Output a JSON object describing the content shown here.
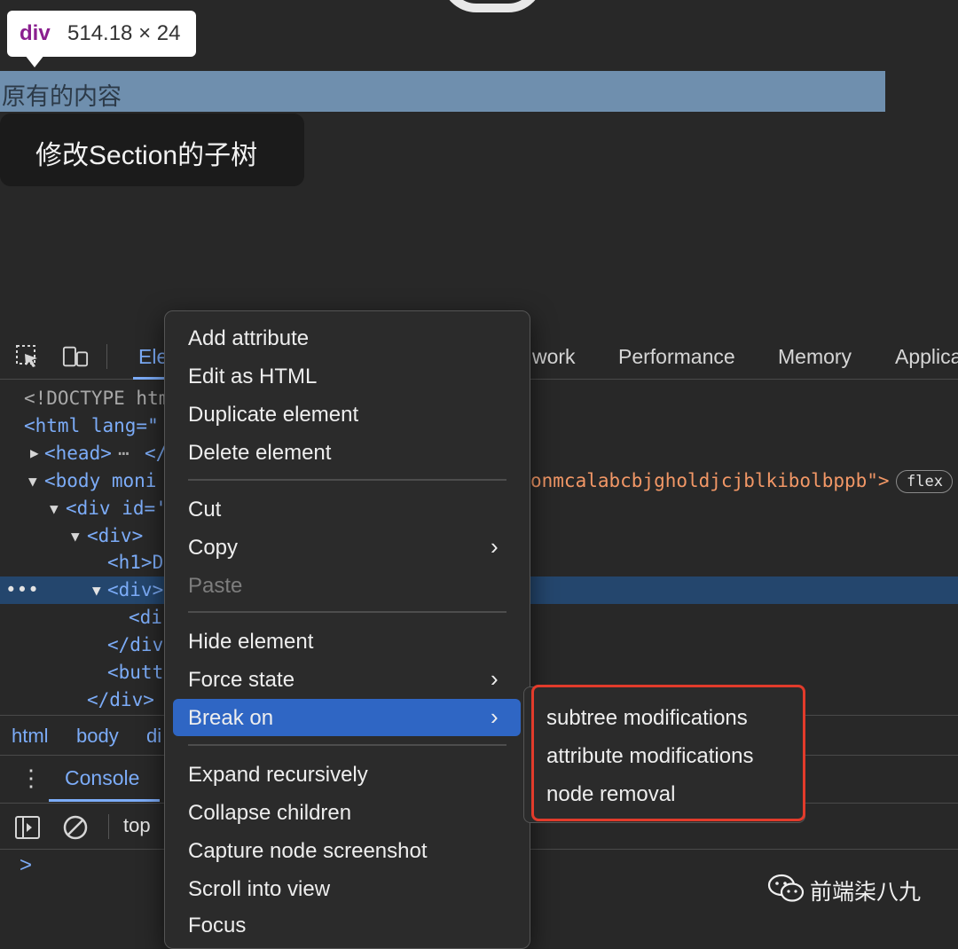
{
  "preview": {
    "tooltip_tag": "div",
    "tooltip_size": "514.18 × 24",
    "highlight_text": "原有的内容",
    "button_label": "修改Section的子树"
  },
  "tabs": {
    "elements": "Ele",
    "network": "work",
    "performance": "Performance",
    "memory": "Memory",
    "application": "Applica"
  },
  "dom": {
    "doctype": "<!DOCTYPE htm",
    "html_open": "<html lang=\"",
    "head": "<head>",
    "head_close": "</",
    "body_open": "<body moni",
    "body_attr_value": "onmcalabcbjgholdjcjblkibolbppb\">",
    "div_id": "<div id='",
    "div": "<div>",
    "h1": "<h1>D",
    "selected_div": "<div>",
    "inner_div": "<di",
    "div_close": "</div",
    "button": "<butt",
    "div_close2": "</div>",
    "flex_badge": "flex"
  },
  "breadcrumb": [
    "html",
    "body",
    "di"
  ],
  "console": {
    "tab_label": "Console",
    "context": "top",
    "prompt": ">"
  },
  "context_menu": {
    "group1": [
      "Add attribute",
      "Edit as HTML",
      "Duplicate element",
      "Delete element"
    ],
    "cut": "Cut",
    "copy": "Copy",
    "paste": "Paste",
    "hide": "Hide element",
    "force_state": "Force state",
    "break_on": "Break on",
    "group4": [
      "Expand recursively",
      "Collapse children",
      "Capture node screenshot",
      "Scroll into view",
      "Focus"
    ]
  },
  "submenu": [
    "subtree modifications",
    "attribute modifications",
    "node removal"
  ],
  "watermark": "前端柒八九",
  "colors": {
    "accent": "#7cacf8",
    "selection": "#2f66c4",
    "highlight_outline": "#e23b2b"
  }
}
